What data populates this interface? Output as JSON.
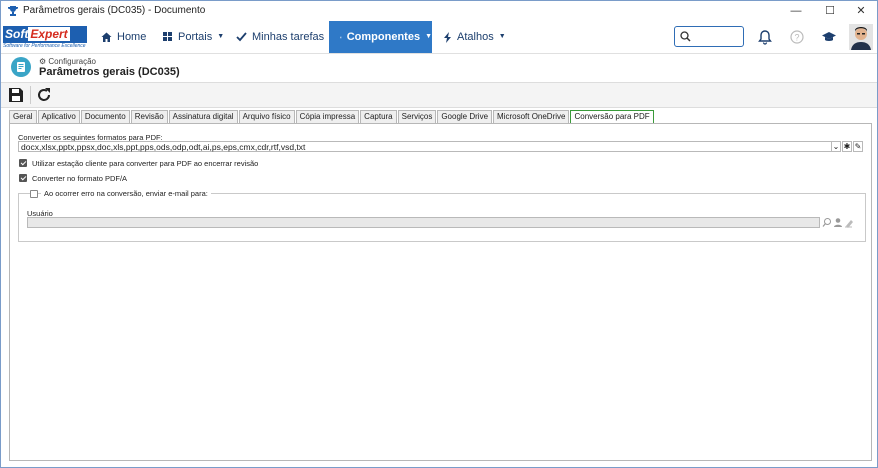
{
  "window": {
    "title": "Parâmetros gerais (DC035) - Documento",
    "controls": [
      "—",
      "☐",
      "✕"
    ]
  },
  "logo": {
    "soft": "Soft",
    "expert": "Expert",
    "tagline": "Software for Performance Excellence"
  },
  "navbar": {
    "items": [
      {
        "label": "Home",
        "icon": "home-icon"
      },
      {
        "label": "Portais",
        "icon": "grid-icon"
      },
      {
        "label": "Minhas tarefas",
        "icon": "check-icon"
      },
      {
        "label": "Componentes",
        "icon": "trophy-icon",
        "active": true
      },
      {
        "label": "Atalhos",
        "icon": "bolt-icon"
      }
    ],
    "accent": "#2f79c7"
  },
  "header": {
    "breadcrumb": "Configuração",
    "title": "Parâmetros gerais (DC035)"
  },
  "tabs": [
    "Geral",
    "Aplicativo",
    "Documento",
    "Revisão",
    "Assinatura digital",
    "Arquivo físico",
    "Cópia impressa",
    "Captura",
    "Serviços",
    "Google Drive",
    "Microsoft OneDrive",
    "Conversão para PDF"
  ],
  "active_tab": "Conversão para PDF",
  "form": {
    "formats_label": "Converter os seguintes formatos para PDF:",
    "formats_value": "docx,xlsx,pptx,ppsx,doc,xls,ppt,pps,ods,odp,odt,ai,ps,eps,cmx,cdr,rtf,vsd,txt",
    "use_client_station_label": "Utilizar estação cliente para converter para PDF ao encerrar revisão",
    "use_client_station_checked": true,
    "pdfa_label": "Converter no formato PDF/A",
    "pdfa_checked": true,
    "email_on_error_label": "Ao ocorrer erro na conversão, enviar e-mail para:",
    "email_on_error_checked": false,
    "user_label": "Usuário",
    "user_value": ""
  }
}
